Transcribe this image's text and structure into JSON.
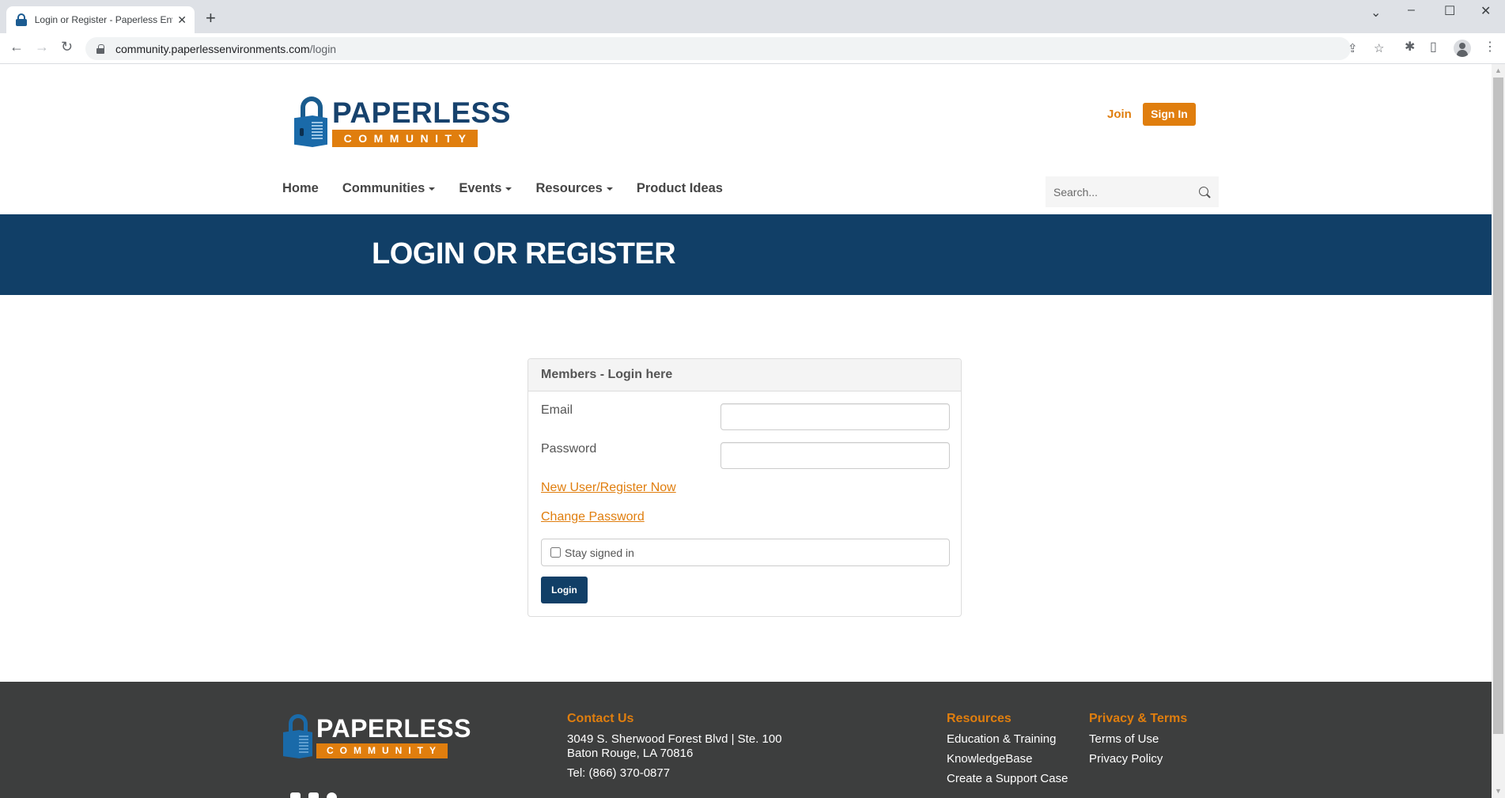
{
  "browser": {
    "tab_title": "Login or Register - Paperless Environments",
    "tab_title_visible": "Login or Register - Paperless Envi",
    "url_host": "community.paperlessenvironments.com",
    "url_path": "/login",
    "icons": {
      "back": "←",
      "forward": "→",
      "reload": "↻",
      "share": "⇪",
      "star": "☆",
      "extensions": "✱",
      "sidepanel": "▯",
      "menu": "⋮",
      "tab_close": "✕",
      "new_tab": "+",
      "tabsearch": "⌄",
      "minimize": "–",
      "maximize": "☐",
      "close": "✕"
    }
  },
  "header": {
    "logo_word": "PAPERLESS",
    "logo_band": "COMMUNITY",
    "join_label": "Join",
    "signin_label": "Sign In",
    "nav": [
      {
        "label": "Home",
        "dropdown": false
      },
      {
        "label": "Communities",
        "dropdown": true
      },
      {
        "label": "Events",
        "dropdown": true
      },
      {
        "label": "Resources",
        "dropdown": true
      },
      {
        "label": "Product Ideas",
        "dropdown": false
      }
    ],
    "search_placeholder": "Search..."
  },
  "banner": {
    "title": "LOGIN OR REGISTER"
  },
  "login": {
    "heading": "Members - Login here",
    "email_label": "Email",
    "email_value": "",
    "password_label": "Password",
    "password_value": "",
    "register_link": "New User/Register Now",
    "change_password_link": "Change Password",
    "stay_signed_in_label": "Stay signed in",
    "stay_signed_in_checked": false,
    "login_button": "Login"
  },
  "footer": {
    "logo_word": "PAPERLESS",
    "logo_band": "COMMUNITY",
    "social": [
      "instagram",
      "twitter",
      "facebook"
    ],
    "contact": {
      "heading": "Contact Us",
      "address_line1": "3049 S. Sherwood Forest Blvd | Ste. 100",
      "address_line2": "Baton Rouge, LA 70816",
      "phone": "Tel: (866) 370-0877"
    },
    "resources": {
      "heading": "Resources",
      "links": [
        "Education & Training",
        "KnowledgeBase",
        "Create a Support Case"
      ]
    },
    "privacy": {
      "heading": "Privacy & Terms",
      "links": [
        "Terms of Use",
        "Privacy Policy"
      ]
    }
  },
  "colors": {
    "brand_navy": "#113f67",
    "brand_orange": "#e07e0e",
    "footer_bg": "#3d3e3e"
  }
}
